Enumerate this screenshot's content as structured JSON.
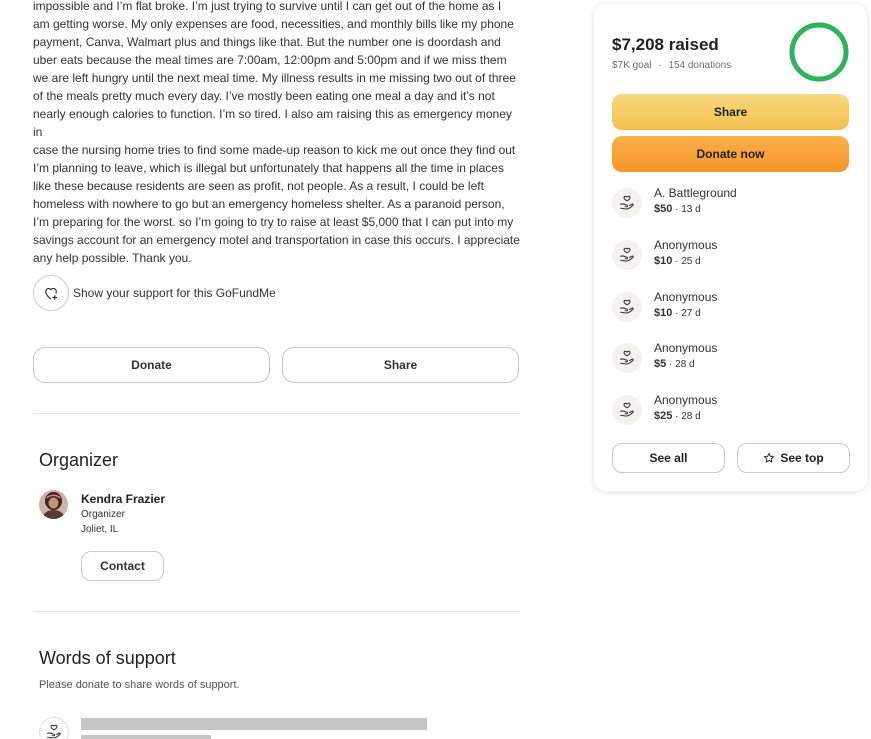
{
  "story": {
    "lines": [
      "impossible and I’m flat broke. I’m just trying to survive until I can get out of the home as I",
      "am getting worse. My only expenses are food, necessities, and monthly bills like my phone",
      "payment, Canva, Walmart plus and things like that. But the number one is doordash and",
      "uber eats because the meal times are 7:00am, 12:00pm and 5:00pm and if we miss them",
      "we are left hungry until the next meal time. My illness results in me missing two out of three",
      "of the meals pretty much every day. I’ve mostly been eating one meal a day and it’s not",
      "nearly enough calories to function. I’m so tired. I also am raising this as emergency money in",
      "case the nursing home tries to find some made-up reason to kick me out once they find out",
      "I’m planning to leave, which is illegal but unfortunately that happens all the time in places",
      "like these because residents are seen as profit, not people. As a result, I could be left",
      "homeless with nowhere to go but an emergency homeless shelter. As a paranoid person,",
      "I’m preparing for the worst. so I’m going to try to raise at least $5,000 that I can put into my",
      "savings account for an emergency motel and transportation in case this occurs. I appreciate",
      "any help possible. Thank you."
    ]
  },
  "support": {
    "label": "Show your support for this GoFundMe"
  },
  "actions": {
    "donate_label": "Donate",
    "share_label": "Share"
  },
  "organizer": {
    "heading": "Organizer",
    "name": "Kendra Frazier",
    "role": "Organizer",
    "location": "Joliet, IL",
    "contact_label": "Contact"
  },
  "words_of_support": {
    "heading": "Words of support",
    "subtitle": "Please donate to share words of support."
  },
  "card": {
    "raised": "$7,208 raised",
    "goal": "$7K goal",
    "separator": "·",
    "donations": "154 donations",
    "progress_fraction": 1.0,
    "share_label": "Share",
    "donate_label": "Donate now",
    "donations_list": [
      {
        "name": "A. Battleground",
        "amount": "$50",
        "age": " · 13 d"
      },
      {
        "name": "Anonymous",
        "amount": "$10",
        "age": " · 25 d"
      },
      {
        "name": "Anonymous",
        "amount": "$10",
        "age": " · 27 d"
      },
      {
        "name": "Anonymous",
        "amount": "$5",
        "age": " · 28 d"
      },
      {
        "name": "Anonymous",
        "amount": "$25",
        "age": " · 28 d"
      }
    ],
    "see_all_label": "See all",
    "see_top_label": "See top"
  },
  "colors": {
    "accent_green": "#2fb35a",
    "share_yellow": "#f5c95a",
    "donate_orange": "#f79e36"
  },
  "icons": [
    "heart-plus-icon",
    "donation-hand-icon",
    "star-icon"
  ]
}
